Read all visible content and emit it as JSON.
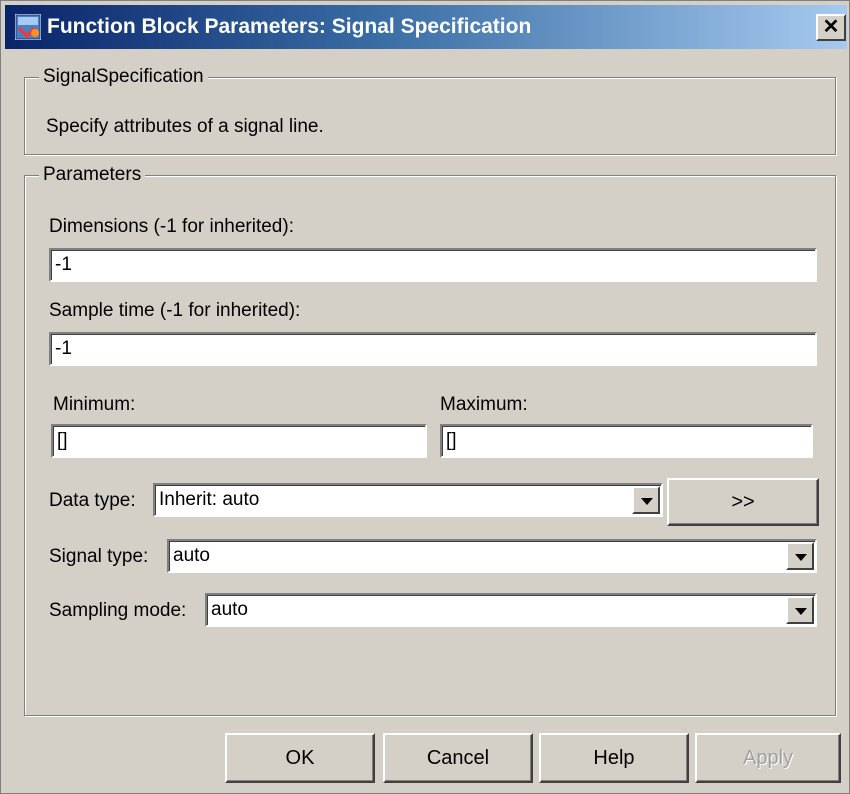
{
  "window": {
    "title": "Function Block Parameters: Signal Specification",
    "close_glyph": "✕"
  },
  "description_group": {
    "legend": "SignalSpecification",
    "text": "Specify attributes of a signal line."
  },
  "parameters_group": {
    "legend": "Parameters",
    "dimensions": {
      "label": "Dimensions (-1 for inherited):",
      "value": "-1"
    },
    "sample_time": {
      "label": "Sample time (-1 for inherited):",
      "value": "-1"
    },
    "minimum": {
      "label": "Minimum:",
      "value": "[]"
    },
    "maximum": {
      "label": "Maximum:",
      "value": "[]"
    },
    "data_type": {
      "label": "Data type:",
      "value": "Inherit: auto",
      "assistant_button": ">>"
    },
    "signal_type": {
      "label": "Signal type:",
      "value": "auto"
    },
    "sampling_mode": {
      "label": "Sampling mode:",
      "value": "auto"
    }
  },
  "buttons": {
    "ok": "OK",
    "cancel": "Cancel",
    "help": "Help",
    "apply": "Apply"
  },
  "icons": {
    "app": "simulink-block-icon",
    "close": "close-icon",
    "dropdown": "chevron-down-icon"
  },
  "colors": {
    "dialog_bg": "#d4d0c8",
    "title_start": "#0a246a",
    "title_end": "#a6caf0"
  }
}
